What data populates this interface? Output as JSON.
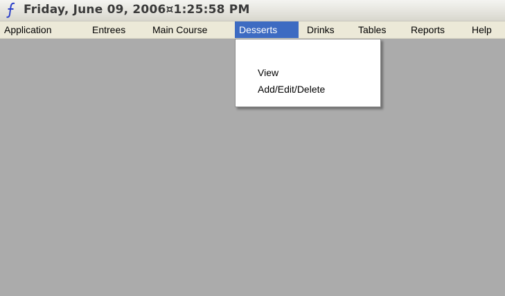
{
  "window": {
    "title": "Friday, June 09, 2006¤1:25:58 PM",
    "icon": "app-logo-icon",
    "colors": {
      "client_area": "#ababab",
      "menu_background": "#ece9d8",
      "menu_highlight": "#3d6bc2",
      "icon_color": "#2a3fc9"
    }
  },
  "menubar": {
    "items": [
      {
        "label": "Application"
      },
      {
        "label": "Entrees"
      },
      {
        "label": "Main Course"
      },
      {
        "label": "Desserts",
        "state": "open"
      },
      {
        "label": "Drinks"
      },
      {
        "label": "Tables"
      },
      {
        "label": "Reports"
      },
      {
        "label": "Help"
      }
    ]
  },
  "dropdown": {
    "parent": "Desserts",
    "items": [
      {
        "label": "View"
      },
      {
        "label": "Add/Edit/Delete"
      }
    ]
  }
}
